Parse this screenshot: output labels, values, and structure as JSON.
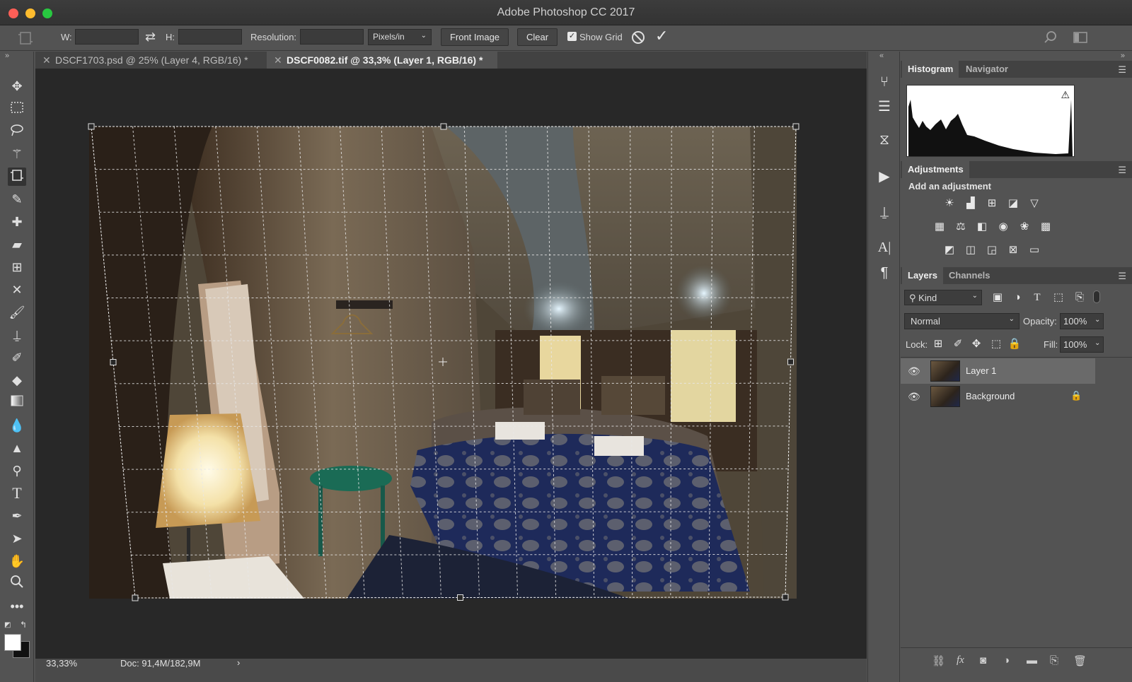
{
  "window": {
    "title": "Adobe Photoshop CC 2017"
  },
  "options_bar": {
    "w_label": "W:",
    "w_value": "",
    "h_label": "H:",
    "h_value": "",
    "resolution_label": "Resolution:",
    "resolution_value": "",
    "units": "Pixels/in",
    "front_image": "Front Image",
    "clear": "Clear",
    "show_grid_label": "Show Grid",
    "show_grid_checked": true
  },
  "documents": [
    {
      "label": "DSCF1703.psd @ 25% (Layer 4, RGB/16) *",
      "active": false
    },
    {
      "label": "DSCF0082.tif @ 33,3% (Layer 1, RGB/16) *",
      "active": true
    }
  ],
  "status": {
    "zoom": "33,33%",
    "doc": "Doc: 91,4M/182,9M"
  },
  "histogram_panel": {
    "tabs": [
      "Histogram",
      "Navigator"
    ]
  },
  "adjustments_panel": {
    "tab": "Adjustments",
    "heading": "Add an adjustment"
  },
  "layers_panel": {
    "tabs": [
      "Layers",
      "Channels"
    ],
    "filter": "Kind",
    "blend_mode": "Normal",
    "opacity_label": "Opacity:",
    "opacity": "100%",
    "lock_label": "Lock:",
    "fill_label": "Fill:",
    "fill": "100%",
    "layers": [
      {
        "name": "Layer 1",
        "visible": true,
        "selected": true
      },
      {
        "name": "Background",
        "visible": true,
        "locked": true
      }
    ]
  },
  "colors": {
    "accent_red": "#ff5f57",
    "accent_yellow": "#febc2e",
    "accent_green": "#28c840",
    "canvas_bg": "#282828",
    "panel_bg": "#535353"
  }
}
